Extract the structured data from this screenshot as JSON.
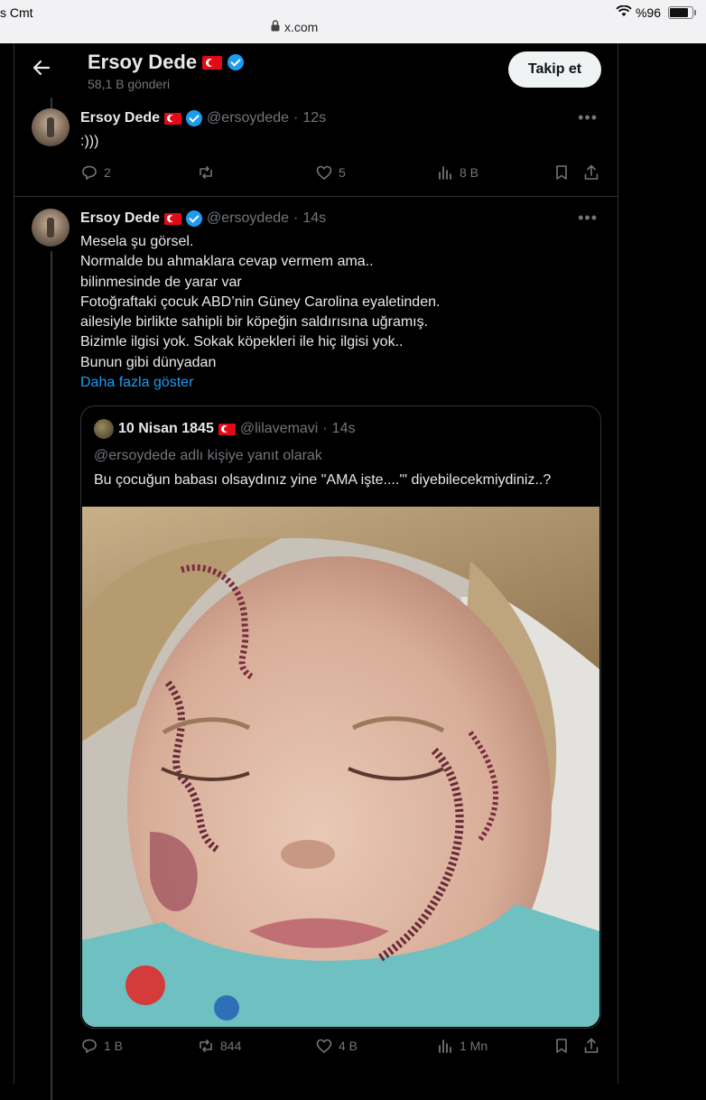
{
  "status": {
    "left_text": "s Cmt",
    "url": "x.com",
    "battery": "%96"
  },
  "header": {
    "title": "Ersoy Dede",
    "subtitle": "58,1 B gönderi",
    "follow_label": "Takip et"
  },
  "tweets": [
    {
      "author": "Ersoy Dede",
      "handle": "@ersoydede",
      "time": "12s",
      "lines": [
        ":)))"
      ],
      "stats": {
        "replies": "2",
        "reposts": "",
        "likes": "5",
        "views": "8 B"
      }
    },
    {
      "author": "Ersoy Dede",
      "handle": "@ersoydede",
      "time": "14s",
      "lines": [
        "Mesela şu görsel.",
        "Normalde bu ahmaklara cevap vermem ama..",
        "bilinmesinde de yarar var",
        "Fotoğraftaki çocuk ABD’nin Güney Carolina eyaletinden.",
        "ailesiyle birlikte sahipli bir köpeğin saldırısına uğramış.",
        "Bizimle ilgisi yok. Sokak köpekleri ile hiç ilgisi yok..",
        "Bunun gibi dünyadan"
      ],
      "show_more": "Daha fazla göster",
      "quote": {
        "author": "10 Nisan 1845",
        "handle": "@lilavemavi",
        "time": "14s",
        "reply_to": "@ersoydede adlı kişiye yanıt olarak",
        "text": "Bu çocuğun babası olsaydınız yine \"AMA işte....'\" diyebilecekmiydiniz..?"
      },
      "stats": {
        "replies": "1 B",
        "reposts": "844",
        "likes": "4 B",
        "views": "1 Mn"
      }
    }
  ],
  "icons": [
    "back-arrow-icon",
    "verified-icon",
    "flag-icon",
    "more-icon",
    "reply-icon",
    "repost-icon",
    "like-icon",
    "views-icon",
    "bookmark-icon",
    "share-icon",
    "wifi-icon",
    "lock-icon",
    "battery-icon"
  ],
  "colors": {
    "accent": "#1d9bf0",
    "background": "#000000",
    "text": "#e7e9ea",
    "muted": "#71767b",
    "flag": "#e30a17"
  }
}
